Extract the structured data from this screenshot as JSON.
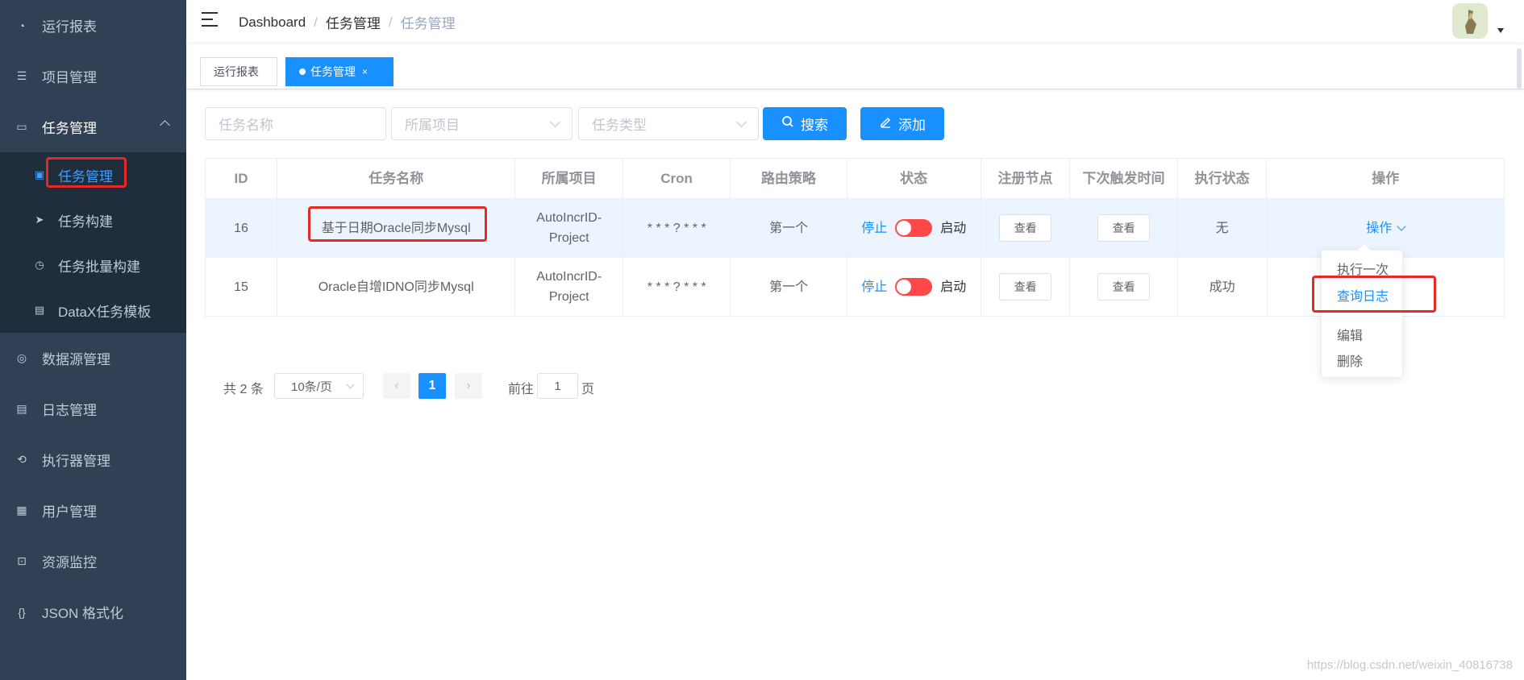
{
  "sidebar": {
    "items": [
      {
        "label": "运行报表",
        "icon": "dashboard-icon"
      },
      {
        "label": "项目管理",
        "icon": "database-icon"
      },
      {
        "label": "任务管理",
        "icon": "monitor-icon"
      },
      {
        "label": "数据源管理",
        "icon": "datasource-icon"
      },
      {
        "label": "日志管理",
        "icon": "document-icon"
      },
      {
        "label": "执行器管理",
        "icon": "executor-icon"
      },
      {
        "label": "用户管理",
        "icon": "grid-icon"
      },
      {
        "label": "资源监控",
        "icon": "monitor-link-icon"
      },
      {
        "label": "JSON 格式化",
        "icon": "braces-icon"
      }
    ],
    "subitems": [
      {
        "label": "任务管理",
        "icon": "calendar-icon"
      },
      {
        "label": "任务构建",
        "icon": "send-icon"
      },
      {
        "label": "任务批量构建",
        "icon": "dial-icon"
      },
      {
        "label": "DataX任务模板",
        "icon": "clipboard-icon"
      }
    ]
  },
  "navbar": {
    "breadcrumb": [
      "Dashboard",
      "任务管理",
      "任务管理"
    ],
    "separator": "/"
  },
  "tags": [
    {
      "label": "运行报表"
    },
    {
      "label": "任务管理",
      "close": "×"
    }
  ],
  "filters": {
    "task_name_placeholder": "任务名称",
    "project_placeholder": "所属项目",
    "task_type_placeholder": "任务类型",
    "search_label": "搜索",
    "add_label": "添加"
  },
  "table": {
    "columns": [
      "ID",
      "任务名称",
      "所属项目",
      "Cron",
      "路由策略",
      "状态",
      "注册节点",
      "下次触发时间",
      "执行状态",
      "操作"
    ],
    "rows": [
      {
        "id": "16",
        "name": "基于日期Oracle同步Mysql",
        "project": "AutoIncrID-Project",
        "cron": "* * * ? * * *",
        "route": "第一个",
        "stop": "停止",
        "start": "启动",
        "node": "查看",
        "next": "查看",
        "exec": "无",
        "op": "操作"
      },
      {
        "id": "15",
        "name": "Oracle自增IDNO同步Mysql",
        "project": "AutoIncrID-Project",
        "cron": "* * * ? * * *",
        "route": "第一个",
        "stop": "停止",
        "start": "启动",
        "node": "查看",
        "next": "查看",
        "exec": "成功",
        "op": ""
      }
    ]
  },
  "dropdown": {
    "items": [
      "执行一次",
      "查询日志",
      "编辑",
      "删除"
    ]
  },
  "pagination": {
    "total": "共 2 条",
    "page_size": "10条/页",
    "current": "1",
    "goto_label": "前往",
    "goto_value": "1",
    "page_suffix": "页",
    "prev": "‹",
    "next": "›"
  },
  "watermark": "https://blog.csdn.net/weixin_40816738",
  "colors": {
    "sidebar_bg": "#304156",
    "accent": "#1890ff",
    "highlight_box": "#e32a27",
    "switch_off": "#ff4949"
  }
}
